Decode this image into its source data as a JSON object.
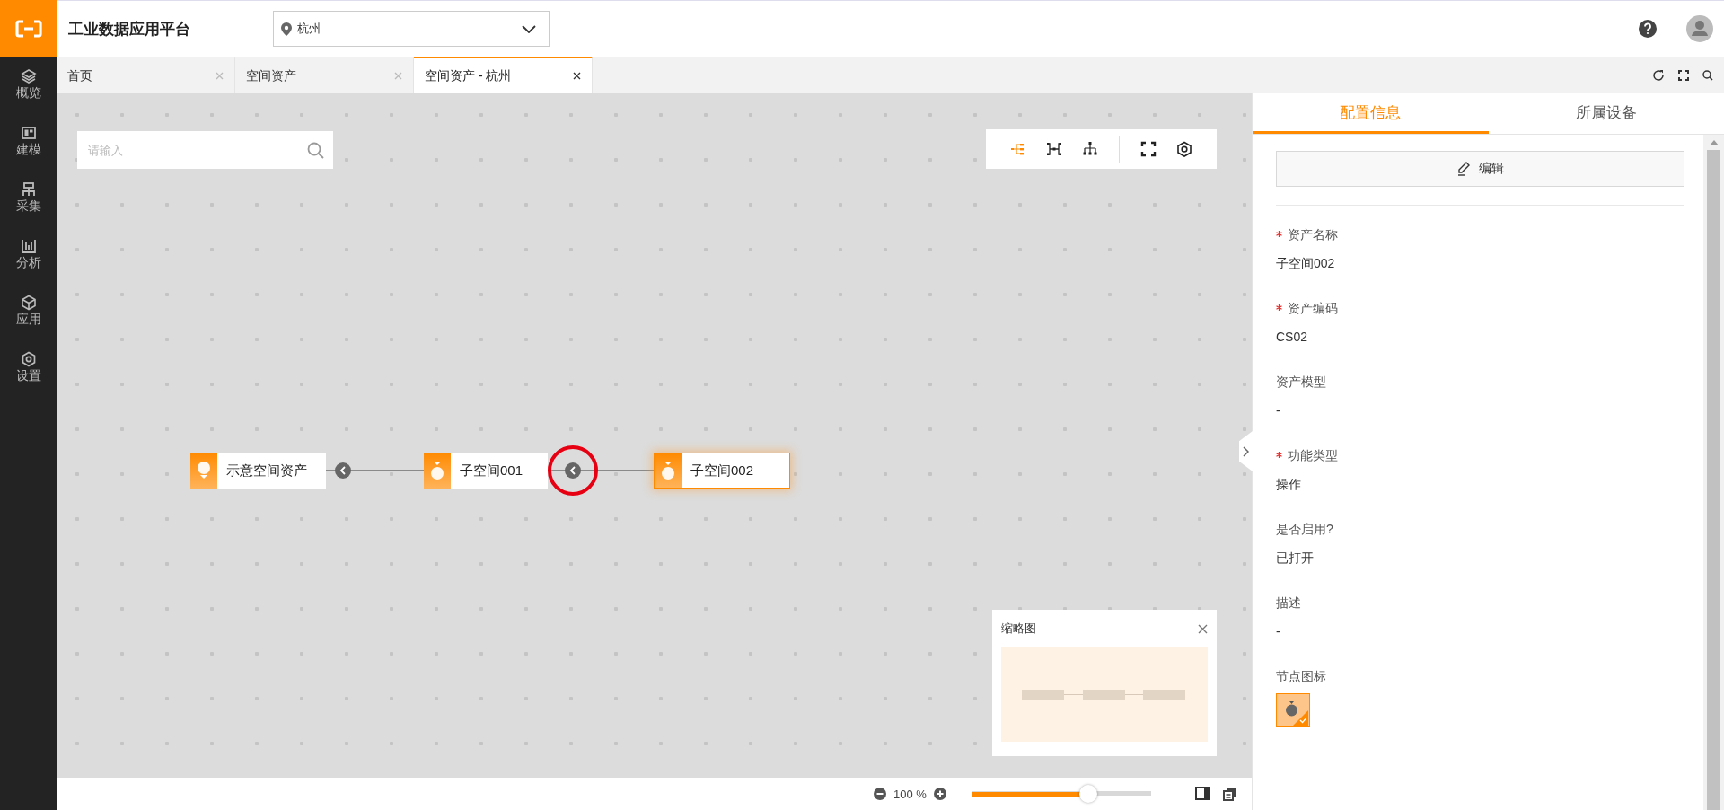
{
  "header": {
    "title": "工业数据应用平台",
    "location": {
      "value": "杭州"
    }
  },
  "sidebar": {
    "items": [
      {
        "kind": "layers",
        "label": "概览"
      },
      {
        "kind": "board",
        "label": "建模"
      },
      {
        "kind": "collect",
        "label": "采集"
      },
      {
        "kind": "chart",
        "label": "分析"
      },
      {
        "kind": "cube",
        "label": "应用"
      },
      {
        "kind": "gear",
        "label": "设置"
      }
    ]
  },
  "tabs": [
    {
      "label": "首页",
      "selected": false
    },
    {
      "label": "空间资产",
      "selected": false
    },
    {
      "label": "空间资产 - 杭州",
      "selected": true
    }
  ],
  "canvas": {
    "search": {
      "placeholder": "请输入"
    },
    "toolbar": [
      {
        "kind": "tree-right",
        "selected": true
      },
      {
        "kind": "spread",
        "selected": false
      },
      {
        "kind": "tree-down",
        "selected": false
      },
      {
        "kind": "fit",
        "selected": false
      },
      {
        "kind": "settings",
        "selected": false
      }
    ],
    "nodes": [
      {
        "label": "示意空间资产",
        "kind": "root",
        "selected": false
      },
      {
        "label": "子空间001",
        "kind": "child",
        "selected": false
      },
      {
        "label": "子空间002",
        "kind": "child",
        "selected": true
      }
    ],
    "edges": [
      {
        "highlighted": false
      },
      {
        "highlighted": true
      }
    ],
    "minimap": {
      "title": "缩略图"
    },
    "zoom": {
      "reading": "100 %",
      "level": 0.65
    }
  },
  "panel": {
    "tabs": [
      {
        "label": "配置信息",
        "selected": true
      },
      {
        "label": "所属设备",
        "selected": false
      }
    ],
    "edit_button": "编辑",
    "fields": [
      {
        "label": "资产名称",
        "required": true,
        "value": "子空间002"
      },
      {
        "label": "资产编码",
        "required": true,
        "value": "CS02"
      },
      {
        "label": "资产模型",
        "required": false,
        "value": "-"
      },
      {
        "label": "功能类型",
        "required": true,
        "value": "操作"
      },
      {
        "label": "是否启用?",
        "required": false,
        "value": "已打开"
      },
      {
        "label": "描述",
        "required": false,
        "value": "-"
      }
    ],
    "node_icon": {
      "label": "节点图标",
      "selected": true
    }
  }
}
